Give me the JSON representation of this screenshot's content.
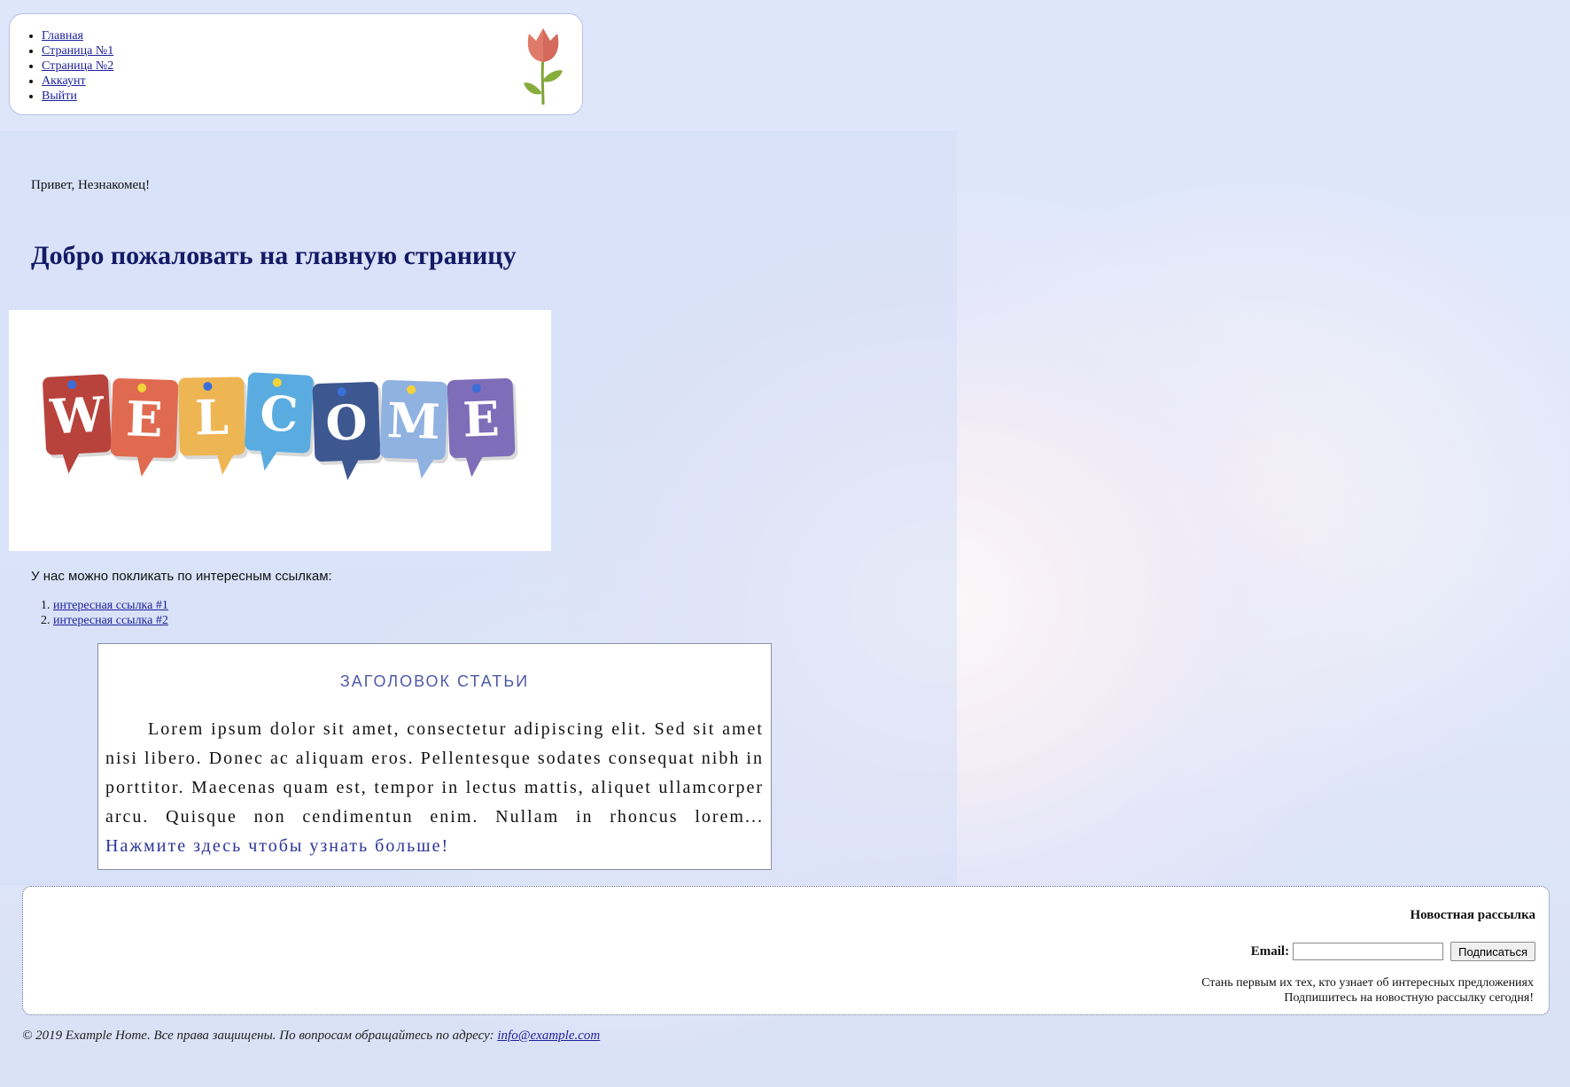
{
  "nav": {
    "items": [
      {
        "label": "Главная"
      },
      {
        "label": "Страница №1"
      },
      {
        "label": "Страница №2"
      },
      {
        "label": "Аккаунт"
      },
      {
        "label": "Выйти"
      }
    ],
    "logo_icon": "tulip-icon"
  },
  "main": {
    "greeting": "Привет, Незнакомец!",
    "title": "Добро пожаловать на главную страницу",
    "welcome_image": {
      "letters": [
        "W",
        "E",
        "L",
        "C",
        "O",
        "M",
        "E"
      ],
      "colors": [
        "#b8433c",
        "#e06a50",
        "#eeb553",
        "#5aace0",
        "#3d5790",
        "#8fb2e0",
        "#7e6db8"
      ]
    },
    "links_intro": "У нас можно покликать по интересным ссылкам:",
    "links": [
      {
        "label": "интересная ссылка #1"
      },
      {
        "label": "интересная ссылка #2"
      }
    ]
  },
  "article": {
    "title": "ЗАГОЛОВОК СТАТЬИ",
    "text": "Lorem ipsum dolor sit amet, consectetur adipiscing elit. Sed sit amet nisi libero. Donec ac aliquam eros. Pellentesque sodates consequat nibh in porttitor. Maecenas quam est, tempor in lectus mattis, aliquet ullamcorper arcu. Quisque non cendimentun enim. Nullam in rhoncus lorem...",
    "more_link": "Нажмите здесь чтобы узнать больше!"
  },
  "newsletter": {
    "title": "Новостная рассылка",
    "email_label": "Email:",
    "email_value": "",
    "subscribe_label": "Подписаться",
    "note_line1": "Стань первым их тех, кто узнает об интересных предложениях",
    "note_line2": "Подпишитесь на новостную рассылку сегодня!"
  },
  "footer": {
    "text": "© 2019 Example Home. Все права защищены. По вопросам обращайтесь по адресу:",
    "email_link": "info@example.com"
  }
}
